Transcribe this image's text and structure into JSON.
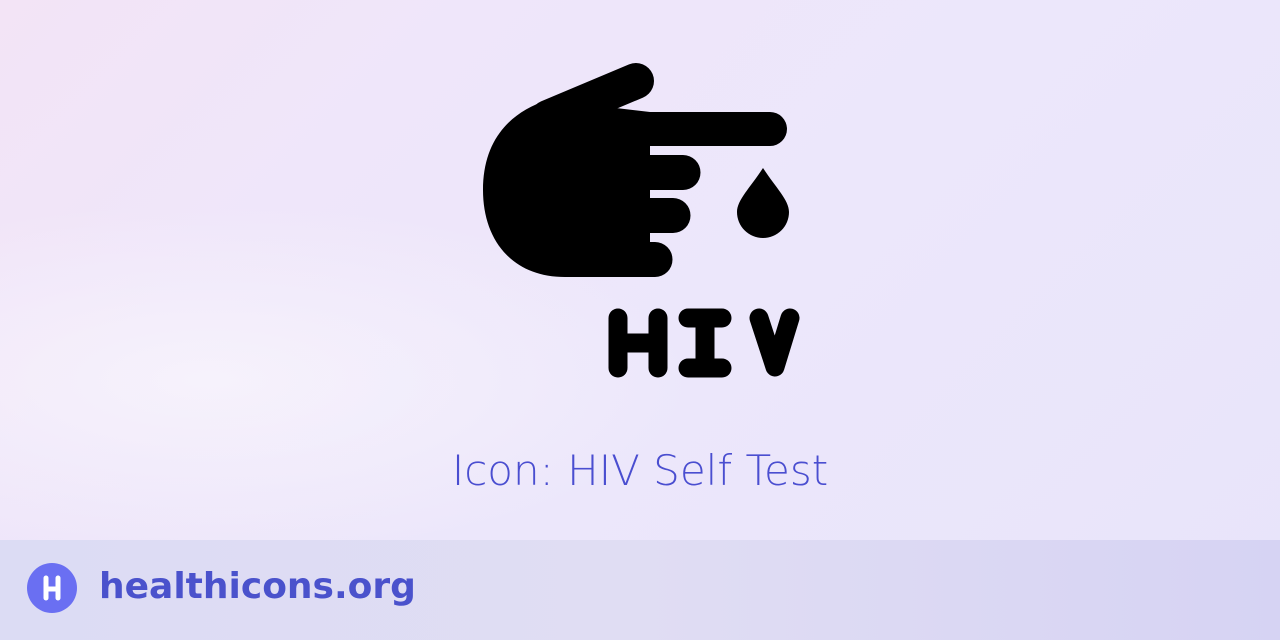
{
  "icon": {
    "name": "hiv-self-test-icon",
    "lettering": "HIV",
    "color": "#000000"
  },
  "title": "Icon: HIV Self Test",
  "footer": {
    "logo_letter": "H",
    "site": "healthicons.org",
    "accent": "#6a6ff2",
    "text_color": "#4a52cc"
  }
}
